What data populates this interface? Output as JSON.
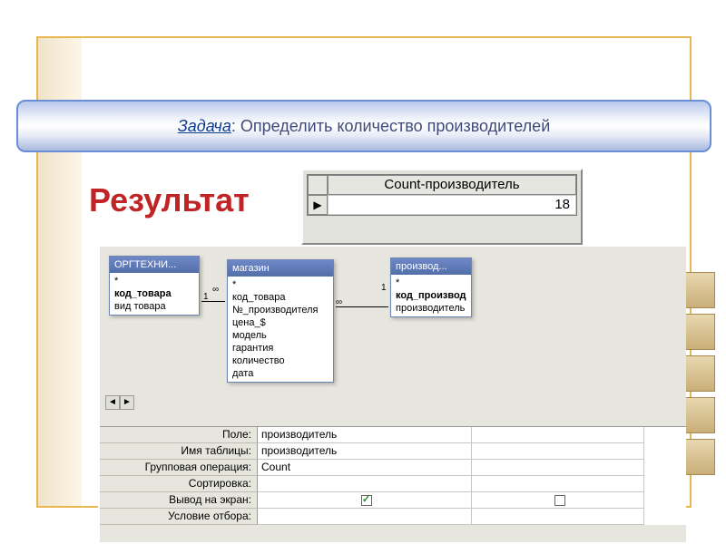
{
  "task": {
    "label": "Задача",
    "text": ": Определить количество производителей"
  },
  "result_heading": "Результат",
  "count_window": {
    "header": "Count-производитель",
    "value": "18",
    "current_marker": "▶"
  },
  "tables": {
    "t1": {
      "title": "ОРГТЕХНИ...",
      "fields": [
        "*",
        "код_товара",
        "вид товара"
      ],
      "bold": [
        1
      ]
    },
    "t2": {
      "title": "магазин",
      "fields": [
        "*",
        "код_товара",
        "№_производителя",
        "цена_$",
        "модель",
        "гарантия",
        "количество",
        "дата"
      ],
      "bold": []
    },
    "t3": {
      "title": "производ...",
      "fields": [
        "*",
        "код_производ",
        "производитель"
      ],
      "bold": [
        1
      ]
    }
  },
  "relations": {
    "one": "1",
    "many": "∞"
  },
  "grid": {
    "labels": {
      "field": "Поле:",
      "table": "Имя таблицы:",
      "groupop": "Групповая операция:",
      "sort": "Сортировка:",
      "show": "Вывод на экран:",
      "criteria": "Условие отбора:"
    },
    "col1": {
      "field": "производитель",
      "table": "производитель",
      "groupop": "Count",
      "sort": "",
      "show_checked": true,
      "criteria": ""
    },
    "col2": {
      "field": "",
      "table": "",
      "groupop": "",
      "sort": "",
      "show_checked": false,
      "criteria": ""
    }
  },
  "scroll": {
    "left": "◄",
    "right": "►"
  },
  "colors": {
    "accent": "#c02424",
    "banner_border": "#6b8fd6"
  }
}
